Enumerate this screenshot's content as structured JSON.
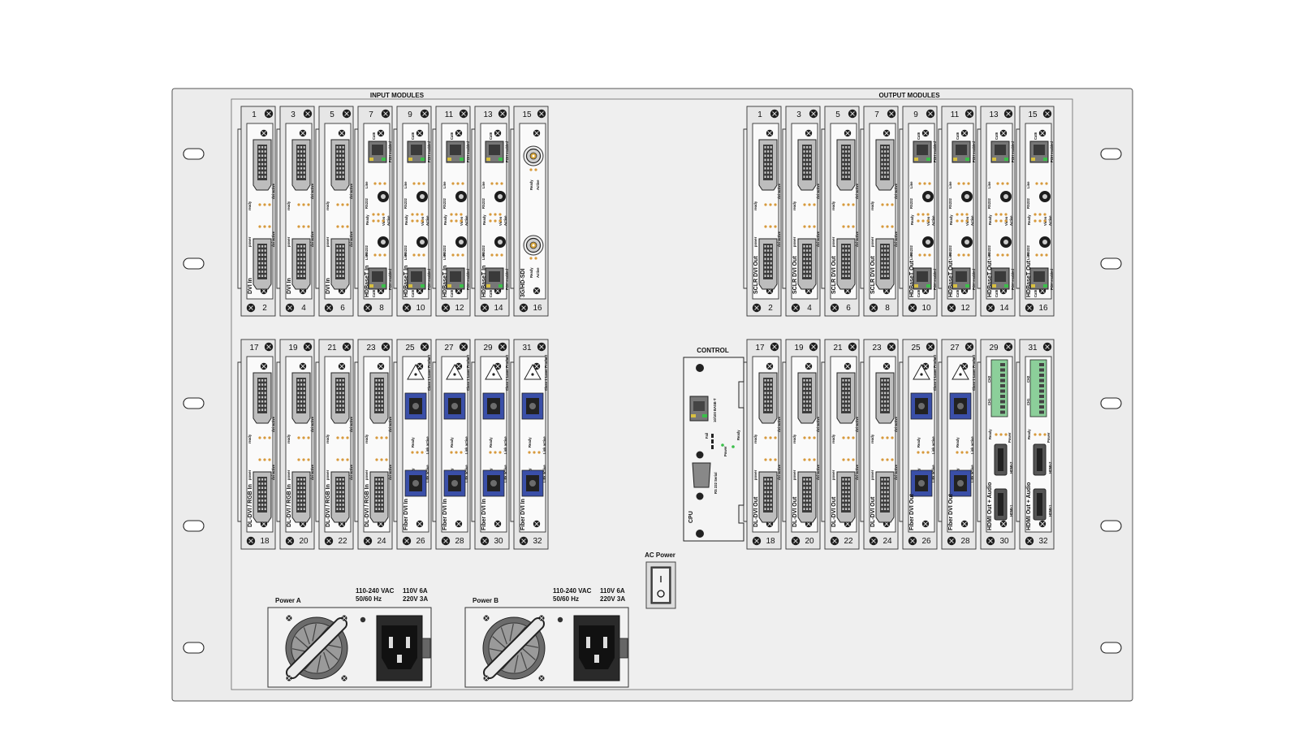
{
  "sections": {
    "input": "INPUT MODULES",
    "output": "OUTPUT MODULES",
    "control": "CONTROL",
    "ac_power": "AC Power"
  },
  "input_top": [
    {
      "top": "1",
      "bottom": "2",
      "label": "DVI In",
      "kind": "dvi"
    },
    {
      "top": "3",
      "bottom": "4",
      "label": "DVI In",
      "kind": "dvi"
    },
    {
      "top": "5",
      "bottom": "6",
      "label": "DVI In",
      "kind": "dvi"
    },
    {
      "top": "7",
      "bottom": "8",
      "label": "HDBaseT In",
      "kind": "hdbt"
    },
    {
      "top": "9",
      "bottom": "10",
      "label": "HDBaseT In",
      "kind": "hdbt"
    },
    {
      "top": "11",
      "bottom": "12",
      "label": "HDBaseT In",
      "kind": "hdbt"
    },
    {
      "top": "13",
      "bottom": "14",
      "label": "HDBaseT In",
      "kind": "hdbt"
    },
    {
      "top": "15",
      "bottom": "16",
      "label": "3G/HD-SDI",
      "kind": "sdi"
    }
  ],
  "input_bottom": [
    {
      "top": "17",
      "bottom": "18",
      "label": "DL-DVI / RGB In",
      "kind": "dvi"
    },
    {
      "top": "19",
      "bottom": "20",
      "label": "DL-DVI / RGB In",
      "kind": "dvi"
    },
    {
      "top": "21",
      "bottom": "22",
      "label": "DL-DVI / RGB In",
      "kind": "dvi"
    },
    {
      "top": "23",
      "bottom": "24",
      "label": "DL-DVI / RGB In",
      "kind": "dvi"
    },
    {
      "top": "25",
      "bottom": "26",
      "label": "Fiber DVI In",
      "kind": "fiber"
    },
    {
      "top": "27",
      "bottom": "28",
      "label": "Fiber DVI In",
      "kind": "fiber"
    },
    {
      "top": "29",
      "bottom": "30",
      "label": "Fiber DVI In",
      "kind": "fiber"
    },
    {
      "top": "31",
      "bottom": "32",
      "label": "Fiber DVI In",
      "kind": "fiber"
    }
  ],
  "output_top": [
    {
      "top": "1",
      "bottom": "2",
      "label": "SCLR DVI Out",
      "kind": "dvi"
    },
    {
      "top": "3",
      "bottom": "4",
      "label": "SCLR DVI Out",
      "kind": "dvi"
    },
    {
      "top": "5",
      "bottom": "6",
      "label": "SCLR DVI Out",
      "kind": "dvi"
    },
    {
      "top": "7",
      "bottom": "8",
      "label": "SCLR DVI Out",
      "kind": "dvi"
    },
    {
      "top": "9",
      "bottom": "10",
      "label": "HDBaseT Out",
      "kind": "hdbt"
    },
    {
      "top": "11",
      "bottom": "12",
      "label": "HDBaseT Out",
      "kind": "hdbt"
    },
    {
      "top": "13",
      "bottom": "14",
      "label": "HDBaseT Out",
      "kind": "hdbt"
    },
    {
      "top": "15",
      "bottom": "16",
      "label": "HDBaseT Out",
      "kind": "hdbt"
    }
  ],
  "output_bottom": [
    {
      "top": "17",
      "bottom": "18",
      "label": "DL-DVI Out",
      "kind": "dvi"
    },
    {
      "top": "19",
      "bottom": "20",
      "label": "DL-DVI Out",
      "kind": "dvi"
    },
    {
      "top": "21",
      "bottom": "22",
      "label": "DL-DVI Out",
      "kind": "dvi"
    },
    {
      "top": "23",
      "bottom": "24",
      "label": "DL-DVI Out",
      "kind": "dvi"
    },
    {
      "top": "25",
      "bottom": "26",
      "label": "Fiber DVI Out",
      "kind": "fiber"
    },
    {
      "top": "27",
      "bottom": "28",
      "label": "Fiber DVI Out",
      "kind": "fiber"
    },
    {
      "top": "29",
      "bottom": "30",
      "label": "HDMI Out + Audio",
      "kind": "hdmi"
    },
    {
      "top": "31",
      "bottom": "32",
      "label": "HDMI Out + Audio",
      "kind": "hdmi"
    }
  ],
  "card_text": {
    "dvi": [
      "ready",
      "dvi active",
      "power"
    ],
    "hdbt": [
      "Cat6",
      "POH enabled",
      "Line",
      "HD",
      "Link",
      "RS232",
      "Ready",
      "Video",
      "Active"
    ],
    "sdi": [
      "Ready",
      "Active"
    ],
    "fiber": [
      "Class 1 Laser Product",
      "Ready",
      "Link active"
    ],
    "hdmi": [
      "CH1",
      "CH2",
      "HDMI-1",
      "HDMI-2",
      "Power",
      "Ready"
    ]
  },
  "control": {
    "eth": "10/100 BASE-T",
    "leds": [
      "Ready",
      "Fail",
      "Power"
    ],
    "serial": "RS 232 Serial",
    "cpu": "CPU"
  },
  "psus": [
    {
      "name": "Power A",
      "rating1": "110-240 VAC",
      "rating2": "50/60 Hz",
      "fuse1": "110V 6A",
      "fuse2": "220V 3A"
    },
    {
      "name": "Power B",
      "rating1": "110-240 VAC",
      "rating2": "50/60 Hz",
      "fuse1": "110V 6A",
      "fuse2": "220V 3A"
    }
  ],
  "colors": {
    "chassis": "#ebebeb",
    "panel": "#f2f2f2",
    "stroke": "#2a2a2a",
    "fiber": "#3a4fa8",
    "led_green": "#3bbf4a",
    "led_amber": "#d79a3c"
  }
}
